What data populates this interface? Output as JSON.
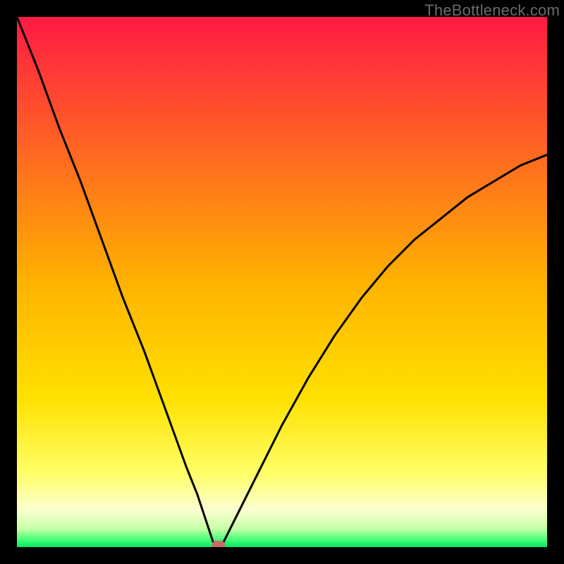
{
  "watermark": "TheBottleneck.com",
  "chart_data": {
    "type": "line",
    "title": "",
    "xlabel": "",
    "ylabel": "",
    "xlim": [
      0,
      100
    ],
    "ylim": [
      0,
      100
    ],
    "grid": false,
    "legend": false,
    "vertex_x": 38,
    "marker": {
      "x": 38,
      "y": 0,
      "color": "#c96a6a"
    },
    "gradient_stops": [
      {
        "pos": 0.0,
        "color": "#ff1a44"
      },
      {
        "pos": 0.5,
        "color": "#ffb200"
      },
      {
        "pos": 0.72,
        "color": "#ffe100"
      },
      {
        "pos": 0.86,
        "color": "#ffff66"
      },
      {
        "pos": 0.93,
        "color": "#fbffd0"
      },
      {
        "pos": 0.965,
        "color": "#c7ffa8"
      },
      {
        "pos": 0.985,
        "color": "#4dff7a"
      },
      {
        "pos": 1.0,
        "color": "#00e864"
      }
    ],
    "series": [
      {
        "name": "curve",
        "x": [
          0,
          4,
          8,
          12,
          16,
          20,
          24,
          28,
          32,
          34,
          36,
          37,
          38,
          39,
          40,
          42,
          46,
          50,
          55,
          60,
          65,
          70,
          75,
          80,
          85,
          90,
          95,
          100
        ],
        "y": [
          100,
          90,
          79,
          69,
          58,
          47,
          37,
          26,
          15,
          10,
          4,
          1,
          0,
          1,
          3,
          7,
          15,
          23,
          32,
          40,
          47,
          53,
          58,
          62,
          66,
          69,
          72,
          74
        ]
      }
    ]
  }
}
